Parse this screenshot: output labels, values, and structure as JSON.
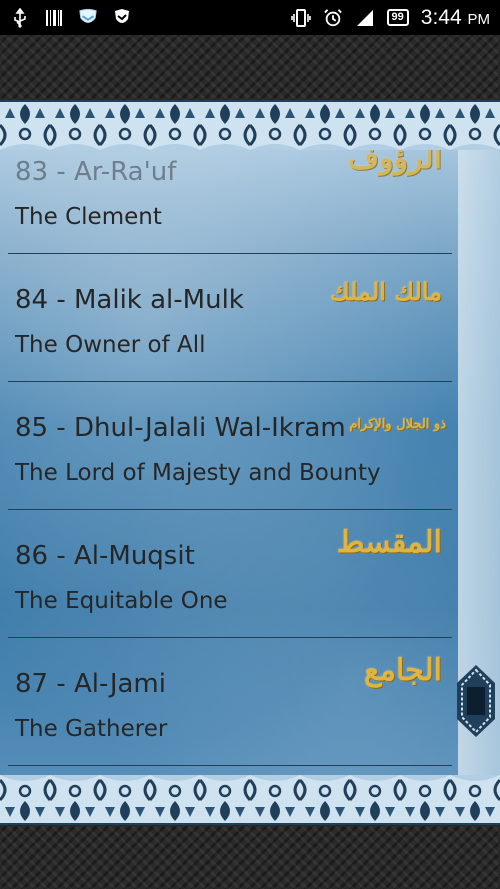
{
  "status_bar": {
    "time": "3:44",
    "time_suffix": "PM",
    "battery": "99",
    "icons_left": [
      "usb-icon",
      "barcode-icon",
      "shield-app-icon",
      "shield-check-icon"
    ],
    "icons_right": [
      "vibrate-icon",
      "alarm-icon",
      "signal-icon",
      "battery-icon"
    ]
  },
  "colors": {
    "accent_gold": "#e0b441",
    "text": "#262626",
    "divider": "#1f3f5a",
    "panel_blue": "#3f7fae"
  },
  "names": [
    {
      "number": "83",
      "transliteration": "Ar-Ra'uf",
      "title": "83 - Ar-Ra'uf",
      "meaning": "The Clement",
      "arabic": "الرؤوف"
    },
    {
      "number": "84",
      "transliteration": "Malik al-Mulk",
      "title": "84 - Malik al-Mulk",
      "meaning": "The Owner of All",
      "arabic": "مالك الملك"
    },
    {
      "number": "85",
      "transliteration": "Dhul-Jalali Wal-Ikram",
      "title": "85 - Dhul-Jalali Wal-Ikram",
      "meaning": "The Lord of Majesty and Bounty",
      "arabic": "ذو الجلال والإكرام"
    },
    {
      "number": "86",
      "transliteration": "Al-Muqsit",
      "title": "86 - Al-Muqsit",
      "meaning": "The Equitable One",
      "arabic": "المقسط"
    },
    {
      "number": "87",
      "transliteration": "Al-Jami",
      "title": "87 - Al-Jami",
      "meaning": "The Gatherer",
      "arabic": "الجامع"
    }
  ]
}
